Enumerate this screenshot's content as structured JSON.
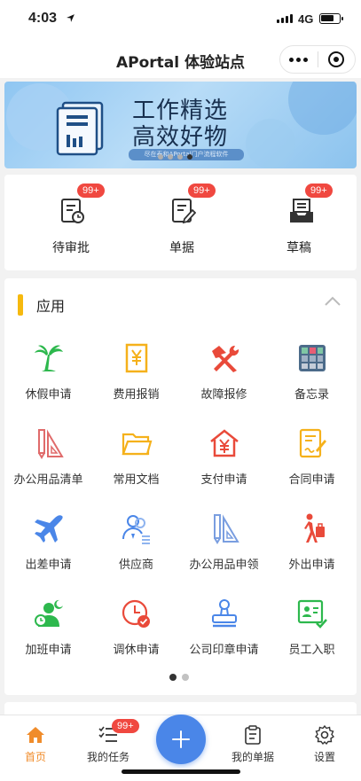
{
  "status": {
    "time": "4:03",
    "network": "4G"
  },
  "navbar": {
    "title": "APortal 体验站点"
  },
  "banner": {
    "line1": "工作精选",
    "line2": "高效好物",
    "sub": "尽在泰和APortal门户流程软件"
  },
  "quick": [
    {
      "label": "待审批",
      "badge": "99+",
      "icon": "pending-approval-icon"
    },
    {
      "label": "单据",
      "badge": "99+",
      "icon": "document-icon"
    },
    {
      "label": "草稿",
      "badge": "99+",
      "icon": "draft-icon"
    }
  ],
  "apps": {
    "title": "应用",
    "items": [
      {
        "label": "休假申请",
        "icon": "palm-tree-icon",
        "color": "#2db84d"
      },
      {
        "label": "费用报销",
        "icon": "yen-receipt-icon",
        "color": "#f5b11b"
      },
      {
        "label": "故障报修",
        "icon": "repair-tools-icon",
        "color": "#e94a3a"
      },
      {
        "label": "备忘录",
        "icon": "memo-grid-icon",
        "color": "#4c6b8a"
      },
      {
        "label": "办公用品清单",
        "icon": "ruler-pencil-icon",
        "color": "#e06b6b"
      },
      {
        "label": "常用文档",
        "icon": "folder-icon",
        "color": "#f5b11b"
      },
      {
        "label": "支付申请",
        "icon": "payment-house-icon",
        "color": "#e94a3a"
      },
      {
        "label": "合同申请",
        "icon": "contract-sign-icon",
        "color": "#f5b11b"
      },
      {
        "label": "出差申请",
        "icon": "airplane-icon",
        "color": "#4a86e8"
      },
      {
        "label": "供应商",
        "icon": "supplier-people-icon",
        "color": "#4a86e8"
      },
      {
        "label": "办公用品申领",
        "icon": "ruler-pencil-blue-icon",
        "color": "#7a9ee0"
      },
      {
        "label": "外出申请",
        "icon": "walking-person-icon",
        "color": "#e94a3a"
      },
      {
        "label": "加班申请",
        "icon": "overtime-person-icon",
        "color": "#2db84d"
      },
      {
        "label": "调休申请",
        "icon": "clock-check-icon",
        "color": "#e94a3a"
      },
      {
        "label": "公司印章申请",
        "icon": "stamp-icon",
        "color": "#4a86e8"
      },
      {
        "label": "员工入职",
        "icon": "id-card-check-icon",
        "color": "#2db84d"
      }
    ]
  },
  "tabbar": {
    "items": [
      {
        "label": "首页",
        "icon": "home-icon",
        "active": true
      },
      {
        "label": "我的任务",
        "icon": "task-list-icon",
        "badge": "99+"
      },
      {
        "label": "我的单据",
        "icon": "clipboard-icon"
      },
      {
        "label": "设置",
        "icon": "settings-icon"
      }
    ]
  }
}
